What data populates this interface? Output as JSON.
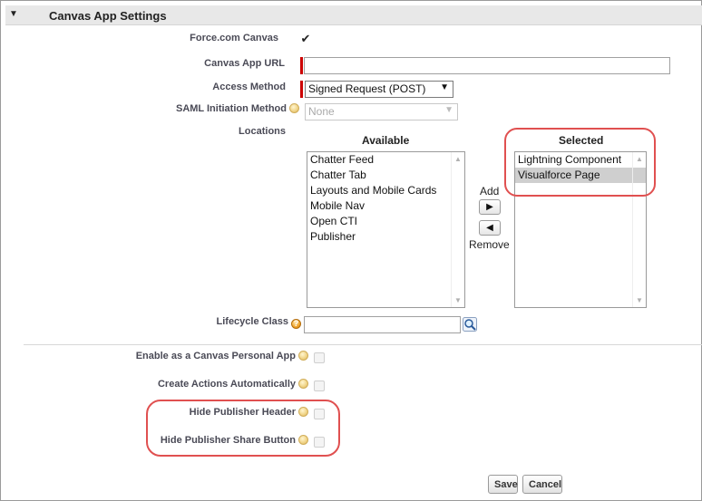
{
  "section": {
    "title": "Canvas App Settings",
    "toggle_icon": "collapse-triangle-icon"
  },
  "fields": {
    "force_canvas": {
      "label": "Force.com Canvas",
      "checked": true
    },
    "canvas_url": {
      "label": "Canvas App URL",
      "value": ""
    },
    "access_method": {
      "label": "Access Method",
      "value": "Signed Request (POST)"
    },
    "saml": {
      "label": "SAML Initiation Method",
      "value": "None"
    },
    "locations": {
      "label": "Locations"
    },
    "lifecycle": {
      "label": "Lifecycle Class",
      "value": ""
    },
    "personal_app": {
      "label": "Enable as a Canvas Personal App",
      "checked": false
    },
    "create_actions": {
      "label": "Create Actions Automatically",
      "checked": false
    },
    "hide_header": {
      "label": "Hide Publisher Header",
      "checked": false
    },
    "hide_share": {
      "label": "Hide Publisher Share Button",
      "checked": false
    }
  },
  "locations": {
    "available_label": "Available",
    "selected_label": "Selected",
    "available": [
      "Chatter Feed",
      "Chatter Tab",
      "Layouts and Mobile Cards",
      "Mobile Nav",
      "Open CTI",
      "Publisher"
    ],
    "selected": [
      "Lightning Component",
      "Visualforce Page"
    ],
    "add_label": "Add",
    "remove_label": "Remove"
  },
  "buttons": {
    "save": "Save",
    "cancel": "Cancel"
  },
  "colors": {
    "highlight": "#e05050",
    "required": "#cc0000"
  }
}
